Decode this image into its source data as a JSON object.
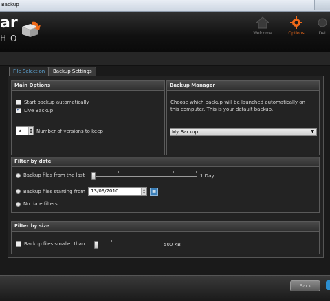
{
  "window": {
    "title": "Backup"
  },
  "brand": {
    "line1": "ar",
    "line2": "HO",
    "accent": "#f06a1a"
  },
  "nav": [
    {
      "label": "Welcome",
      "icon": "home-icon"
    },
    {
      "label": "Options",
      "icon": "gear-icon",
      "active": true
    },
    {
      "label": "Det",
      "icon": "gear-icon"
    }
  ],
  "tabs": [
    {
      "label": "File Selection"
    },
    {
      "label": "Backup Settings",
      "active": true
    }
  ],
  "main_options": {
    "title": "Main Options",
    "start_backup": {
      "label": "Start backup automatically",
      "checked": false
    },
    "live_backup": {
      "label": "Live Backup",
      "checked": true
    },
    "versions": {
      "value": "3",
      "label": "Number of versions to keep"
    }
  },
  "backup_manager": {
    "title": "Backup Manager",
    "description": "Choose which backup will be launched automatically on this computer. This is your default backup.",
    "selected": "My Backup"
  },
  "filter_date": {
    "title": "Filter by date",
    "from_last": {
      "label": "Backup files from the last",
      "value": "1 Day",
      "level": 0
    },
    "starting_from": {
      "label": "Backup files starting from",
      "date": "13/09/2010"
    },
    "no_filter": {
      "label": "No date filters",
      "selected": true
    }
  },
  "filter_size": {
    "title": "Filter by size",
    "smaller_than": {
      "label": "Backup files smaller than",
      "value": "500 KB",
      "checked": false,
      "level": 0
    }
  },
  "footer": {
    "back_label": "Back"
  }
}
